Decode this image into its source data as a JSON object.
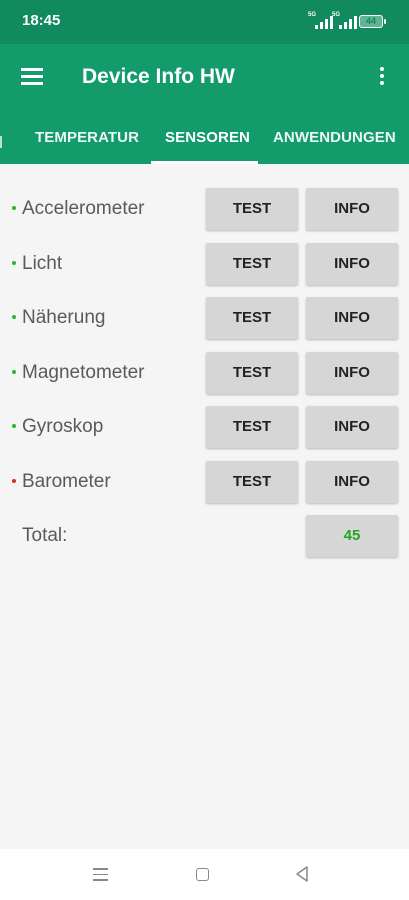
{
  "status": {
    "time": "18:45",
    "signal1_label": "5G",
    "signal2_label": "5G",
    "battery": "44"
  },
  "appbar": {
    "title": "Device Info HW"
  },
  "tabs": [
    {
      "label": "TEMPERATUR"
    },
    {
      "label": "SENSOREN",
      "selected": true
    },
    {
      "label": "ANWENDUNGEN"
    }
  ],
  "sensors": [
    {
      "name": "Accelerometer",
      "status_color": "#2db52d",
      "test_label": "TEST",
      "info_label": "INFO"
    },
    {
      "name": "Licht",
      "status_color": "#2db52d",
      "test_label": "TEST",
      "info_label": "INFO"
    },
    {
      "name": "Näherung",
      "status_color": "#2db52d",
      "test_label": "TEST",
      "info_label": "INFO"
    },
    {
      "name": "Magnetometer",
      "status_color": "#2db52d",
      "test_label": "TEST",
      "info_label": "INFO"
    },
    {
      "name": "Gyroskop",
      "status_color": "#2db52d",
      "test_label": "TEST",
      "info_label": "INFO"
    },
    {
      "name": "Barometer",
      "status_color": "#d32f2f",
      "test_label": "TEST",
      "info_label": "INFO"
    }
  ],
  "total": {
    "label": "Total:",
    "value": "45",
    "value_color": "#22a622"
  },
  "colors": {
    "primary": "#139b6c",
    "status_bar": "#108a5e"
  },
  "icons": {
    "menu": "hamburger-menu-icon",
    "more": "more-vertical-icon",
    "nav_menu": "recent-apps-icon",
    "nav_home": "home-icon",
    "nav_back": "back-icon"
  }
}
